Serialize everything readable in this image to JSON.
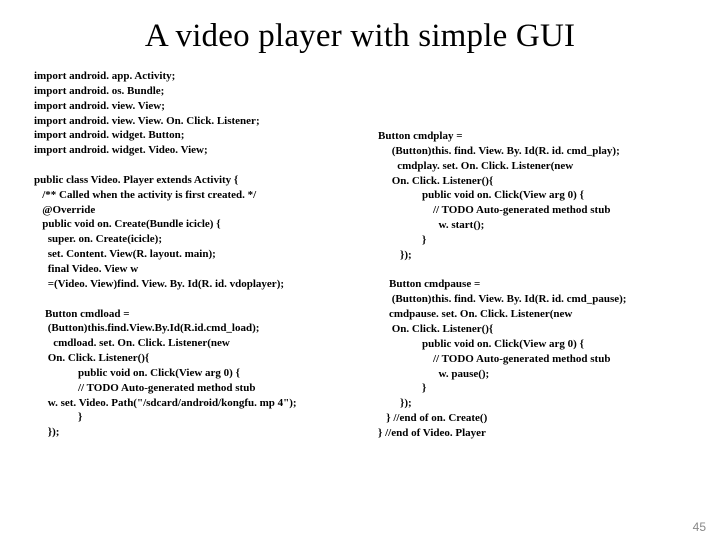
{
  "title": "A video player with simple GUI",
  "page_number": "45",
  "code_left": "import android. app. Activity;\nimport android. os. Bundle;\nimport android. view. View;\nimport android. view. View. On. Click. Listener;\nimport android. widget. Button;\nimport android. widget. Video. View;\n\npublic class Video. Player extends Activity {\n   /** Called when the activity is first created. */\n   @Override\n   public void on. Create(Bundle icicle) {\n     super. on. Create(icicle);\n     set. Content. View(R. layout. main);\n     final Video. View w\n     =(Video. View)find. View. By. Id(R. id. vdoplayer);\n\n    Button cmdload =\n     (Button)this.find.View.By.Id(R.id.cmd_load);\n       cmdload. set. On. Click. Listener(new\n     On. Click. Listener(){\n                public void on. Click(View arg 0) {\n                // TODO Auto-generated method stub\n     w. set. Video. Path(\"/sdcard/android/kongfu. mp 4\");\n                }\n     });",
  "code_right": "Button cmdplay =\n     (Button)this. find. View. By. Id(R. id. cmd_play);\n       cmdplay. set. On. Click. Listener(new\n     On. Click. Listener(){\n                public void on. Click(View arg 0) {\n                    // TODO Auto-generated method stub\n                      w. start();\n                }\n        });\n\n    Button cmdpause =\n     (Button)this. find. View. By. Id(R. id. cmd_pause);\n    cmdpause. set. On. Click. Listener(new\n     On. Click. Listener(){\n                public void on. Click(View arg 0) {\n                    // TODO Auto-generated method stub\n                      w. pause();\n                }\n        });\n   } //end of on. Create()\n} //end of Video. Player"
}
